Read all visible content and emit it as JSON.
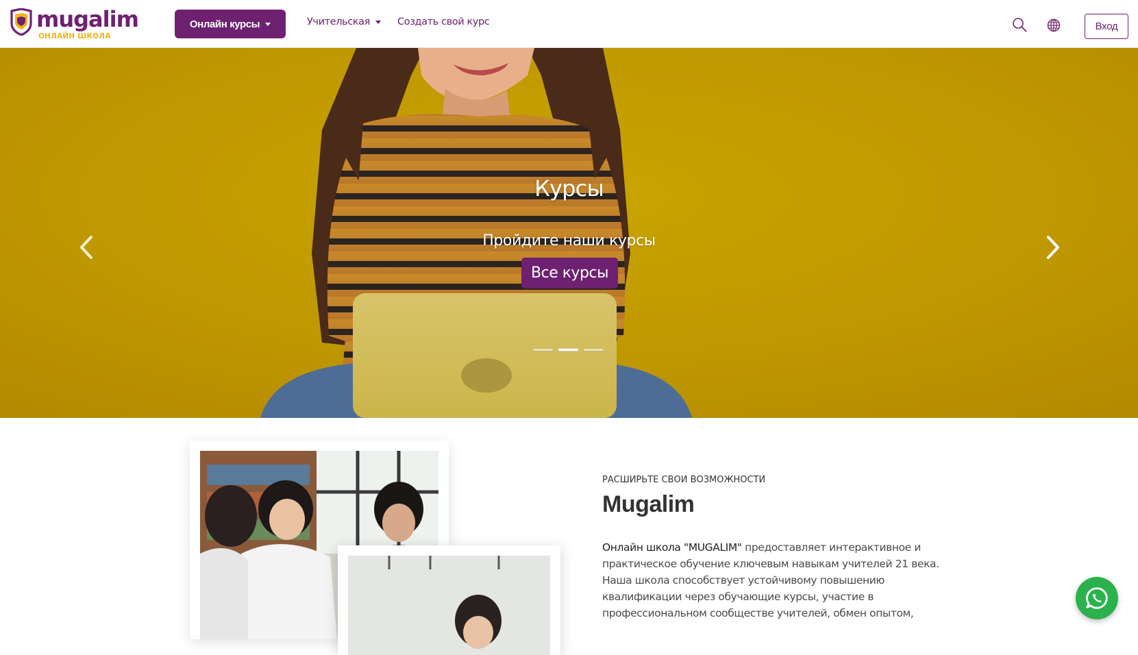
{
  "brand": {
    "name": "mugalim",
    "tagline": "ОНЛАЙН ШКОЛА",
    "primary_color": "#6e2170",
    "accent_color": "#f2b316"
  },
  "header": {
    "courses_button": "Онлайн курсы",
    "teacher_link": "Учительская",
    "create_course_link": "Создать свой курс",
    "search_icon": "search-icon",
    "language_icon": "globe-icon",
    "login_button": "Вход"
  },
  "hero": {
    "title": "Курсы",
    "subtitle": "Пройдите наши курсы",
    "button_label": "Все курсы",
    "slides_count": 3,
    "active_slide": 2,
    "background_color": "#c39a00"
  },
  "about": {
    "kicker": "РАСШИРЬТЕ СВОИ ВОЗМОЖНОСТИ",
    "title": "Mugalim",
    "text_lead": "Онлайн школа \"MUGALIM\"",
    "text_body": " предоставляет интерактивное и практическое обучение ключевым навыкам учителей 21 века. Наша школа способствует устойчивому повышению квалификации через обучающие курсы, участие в профессиональном сообществе учителей, обмен опытом,"
  },
  "floating": {
    "whatsapp_icon": "whatsapp-icon",
    "whatsapp_color": "#2bb24c"
  }
}
